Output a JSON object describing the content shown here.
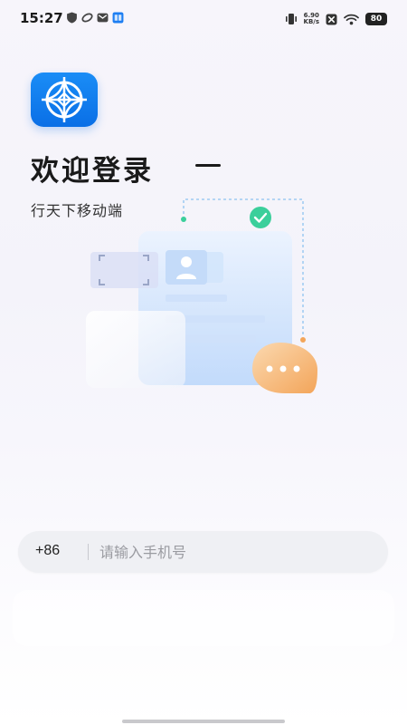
{
  "status_bar": {
    "time": "15:27",
    "net_speed_value": "6.90",
    "net_speed_unit": "KB/s",
    "battery": "80",
    "left_icons": [
      "shield-icon",
      "loop-icon",
      "mail-icon",
      "app-badge-icon"
    ],
    "right_icons": [
      "vibrate-icon",
      "sim-off-icon",
      "wifi-icon",
      "battery-icon"
    ]
  },
  "login": {
    "title": "欢迎登录",
    "subtitle": "行天下移动端"
  },
  "phone": {
    "country_code": "+86",
    "placeholder": "请输入手机号"
  },
  "colors": {
    "brand_blue": "#0a6fe6",
    "illustration_green": "#3bcf9b",
    "chat_bubble_orange": "#f7b26b"
  }
}
